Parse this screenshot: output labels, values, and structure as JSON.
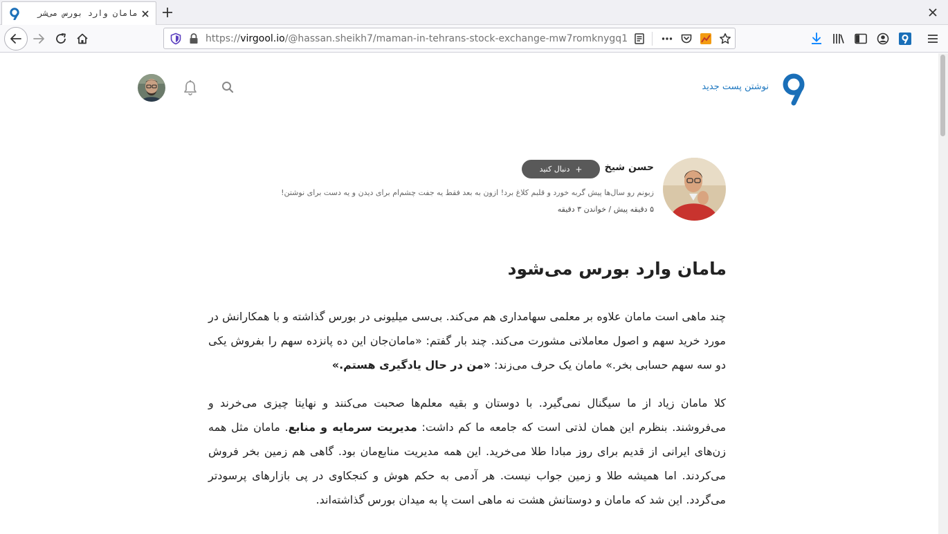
{
  "browser": {
    "tab_title": "مامان وارد بورس می‌شر",
    "url_prefix": "https://",
    "url_host": "virgool.io",
    "url_path": "/@hassan.sheikh7/maman-in-tehrans-stock-exchange-mw7romknygq1"
  },
  "site": {
    "write_post": "نوشتن پست جدید"
  },
  "author": {
    "name": "حسن شیخ",
    "follow": "دنبال کنید",
    "follow_icon": "+",
    "bio": "زبونم رو سال‌ها پیش گربه خورد و قلبم کلاغ برد! ازون به بعد فقط یه جفت چشم‌ام برای دیدن و یه دست برای نوشتن!",
    "meta": "۵ دقیقه پیش / خواندن ۳ دقیقه"
  },
  "post": {
    "title": "مامان وارد بورس می‌شود",
    "p1_text": "چند ماهی است مامان علاوه بر معلمی سهامداری هم می‌کند. بی‌سی میلیونی در بورس گذاشته و با همکارانش در مورد خرید سهم و اصول معاملاتی مشورت می‌کند. چند بار گفتم: «مامان‌جان این ده پانزده سهم را بفروش یکی دو سه سهم حسابی بخر.» مامان یک حرف می‌زند: ",
    "p1_bold": "«من در حال یادگیری هستم.»",
    "p2_text_a": "کلا مامان زیاد از ما سیگنال نمی‌گیرد. با دوستان و بقیه معلم‌ها صحبت می‌کنند و نهایتا چیزی می‌خرند و می‌فروشند. بنظرم این همان لذتی است که جامعه ما کم داشت: ",
    "p2_bold": "مدیریت سرمایه و منابع",
    "p2_text_b": ". مامان مثل همه زن‌های ایرانی از قدیم برای روز مبادا طلا می‌خرید. این همه مدیریت منابع‌مان بود. گاهی هم زمین بخر فروش می‌کردند. اما همیشه طلا و زمین جواب نیست. هر آدمی به حکم هوش و کنجکاوی در پی بازارهای پرسودتر می‌گردد. این شد که مامان و دوستانش هشت نه ماهی است پا به میدان بورس گذاشته‌اند."
  },
  "colors": {
    "accent": "#1c76bf",
    "follow_bg": "#595959"
  },
  "icons": [
    "virgool-logo-icon",
    "search-icon",
    "bell-icon",
    "back-icon",
    "forward-icon",
    "reload-icon",
    "home-icon",
    "shield-icon",
    "lock-icon",
    "reader-icon",
    "more-icon",
    "pocket-icon",
    "chart-icon",
    "star-icon",
    "download-icon",
    "library-icon",
    "sidebar-icon",
    "account-icon",
    "menu-icon"
  ]
}
